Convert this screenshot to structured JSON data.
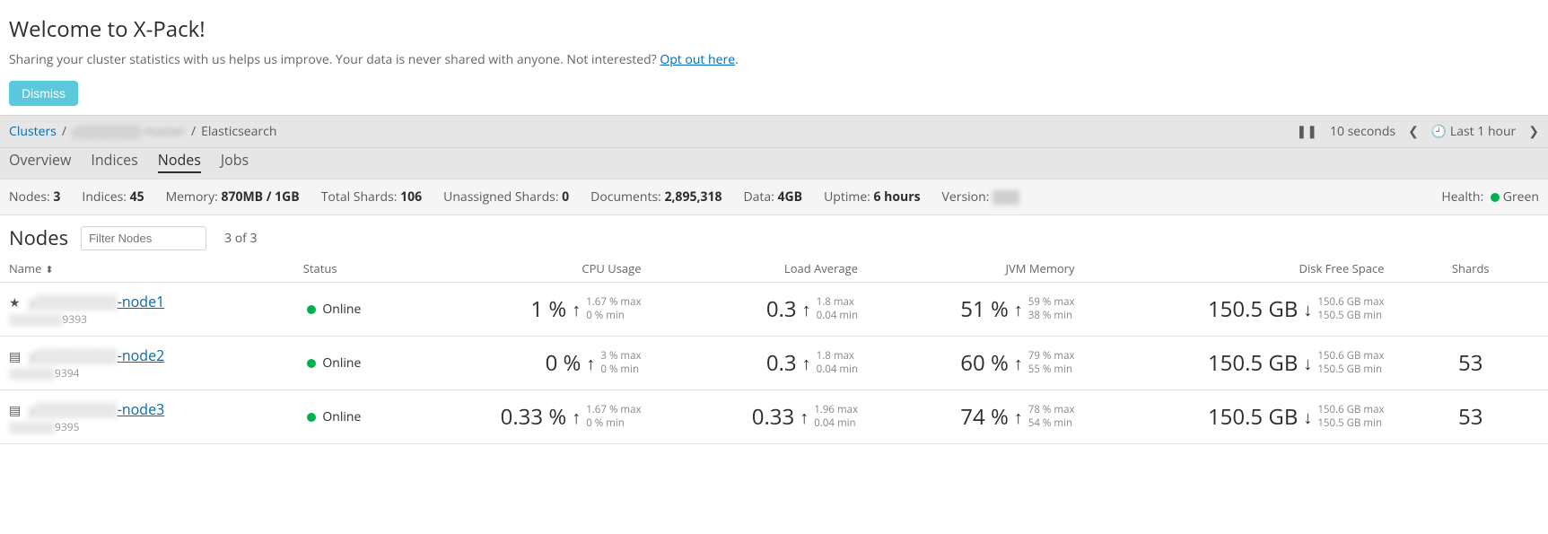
{
  "welcome": {
    "heading": "Welcome to X-Pack!",
    "text_before": "Sharing your cluster statistics with us helps us improve. Your data is never shared with anyone. Not interested? ",
    "opt_out": "Opt out here",
    "dismiss": "Dismiss"
  },
  "breadcrumb": {
    "clusters": "Clusters",
    "cluster_name": "y▒▒▒▒▒▒▒-master",
    "current": "Elasticsearch"
  },
  "time": {
    "interval": "10 seconds",
    "range": "Last 1 hour"
  },
  "tabs": {
    "overview": "Overview",
    "indices": "Indices",
    "nodes": "Nodes",
    "jobs": "Jobs",
    "active": "nodes"
  },
  "stats": {
    "nodes_label": "Nodes:",
    "nodes": "3",
    "indices_label": "Indices:",
    "indices": "45",
    "memory_label": "Memory:",
    "memory": "870MB / 1GB",
    "total_shards_label": "Total Shards:",
    "total_shards": "106",
    "unassigned_label": "Unassigned Shards:",
    "unassigned": "0",
    "documents_label": "Documents:",
    "documents": "2,895,318",
    "data_label": "Data:",
    "data": "4GB",
    "uptime_label": "Uptime:",
    "uptime": "6 hours",
    "version_label": "Version:",
    "version": "▒▒▒",
    "health_label": "Health:",
    "health": "Green"
  },
  "section": {
    "title": "Nodes",
    "filter_placeholder": "Filter Nodes",
    "count": "3 of 3"
  },
  "columns": {
    "name": "Name",
    "status": "Status",
    "cpu": "CPU Usage",
    "load": "Load Average",
    "jvm": "JVM Memory",
    "disk": "Disk Free Space",
    "shards": "Shards"
  },
  "nodes_rows": [
    {
      "icon": "star",
      "name": "y▒▒▒▒▒▒▒▒-node1",
      "sub": "▒▒▒▒▒▒▒9393",
      "status": "Online",
      "cpu": {
        "val": "1 %",
        "arrow": "↑",
        "max": "1.67 % max",
        "min": "0 % min"
      },
      "load": {
        "val": "0.3",
        "arrow": "↑",
        "max": "1.8 max",
        "min": "0.04 min"
      },
      "jvm": {
        "val": "51 %",
        "arrow": "↑",
        "max": "59 % max",
        "min": "38 % min"
      },
      "disk": {
        "val": "150.5 GB",
        "arrow": "↓",
        "max": "150.6 GB max",
        "min": "150.5 GB min"
      },
      "shards": ""
    },
    {
      "icon": "server",
      "name": "y▒▒▒▒▒▒▒▒-node2",
      "sub": "▒▒▒▒▒▒9394",
      "status": "Online",
      "cpu": {
        "val": "0 %",
        "arrow": "↑",
        "max": "3 % max",
        "min": "0 % min"
      },
      "load": {
        "val": "0.3",
        "arrow": "↑",
        "max": "1.8 max",
        "min": "0.04 min"
      },
      "jvm": {
        "val": "60 %",
        "arrow": "↑",
        "max": "79 % max",
        "min": "55 % min"
      },
      "disk": {
        "val": "150.5 GB",
        "arrow": "↓",
        "max": "150.6 GB max",
        "min": "150.5 GB min"
      },
      "shards": "53"
    },
    {
      "icon": "server",
      "name": "y▒▒▒▒▒▒▒▒-node3",
      "sub": "▒▒▒▒▒▒9395",
      "status": "Online",
      "cpu": {
        "val": "0.33 %",
        "arrow": "↑",
        "max": "1.67 % max",
        "min": "0 % min"
      },
      "load": {
        "val": "0.33",
        "arrow": "↑",
        "max": "1.96 max",
        "min": "0.04 min"
      },
      "jvm": {
        "val": "74 %",
        "arrow": "↑",
        "max": "78 % max",
        "min": "54 % min"
      },
      "disk": {
        "val": "150.5 GB",
        "arrow": "↓",
        "max": "150.6 GB max",
        "min": "150.5 GB min"
      },
      "shards": "53"
    }
  ]
}
